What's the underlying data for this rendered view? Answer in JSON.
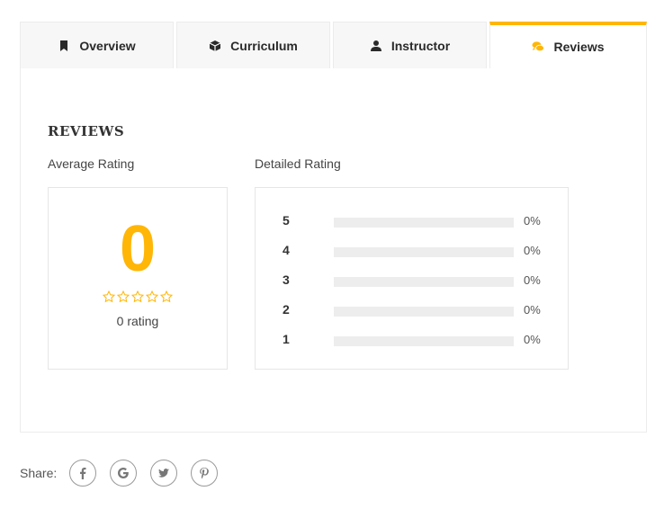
{
  "tabs": [
    {
      "label": "Overview",
      "icon": "bookmark-icon"
    },
    {
      "label": "Curriculum",
      "icon": "cube-icon"
    },
    {
      "label": "Instructor",
      "icon": "user-icon"
    },
    {
      "label": "Reviews",
      "icon": "comments-icon",
      "active": true
    }
  ],
  "reviews": {
    "heading": "REVIEWS",
    "average_label": "Average Rating",
    "detailed_label": "Detailed Rating",
    "average_value": "0",
    "rating_count": "0 rating",
    "stars_filled": 0,
    "stars_total": 5,
    "detailed": [
      {
        "stars": "5",
        "percent": "0%",
        "value": 0
      },
      {
        "stars": "4",
        "percent": "0%",
        "value": 0
      },
      {
        "stars": "3",
        "percent": "0%",
        "value": 0
      },
      {
        "stars": "2",
        "percent": "0%",
        "value": 0
      },
      {
        "stars": "1",
        "percent": "0%",
        "value": 0
      }
    ]
  },
  "share": {
    "label": "Share:",
    "networks": [
      "facebook-icon",
      "google-icon",
      "twitter-icon",
      "pinterest-icon"
    ]
  },
  "colors": {
    "accent": "#ffb606",
    "bar_bg": "#ededed",
    "border": "#e6e6e6"
  }
}
